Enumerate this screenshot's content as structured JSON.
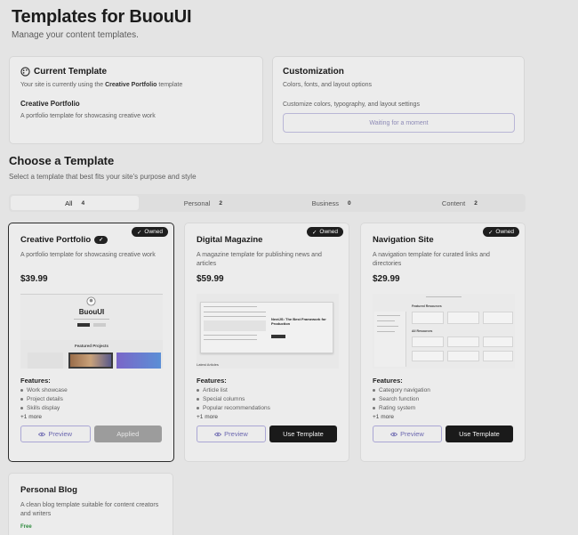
{
  "header": {
    "title": "Templates for BuouUI",
    "subtitle": "Manage your content templates."
  },
  "current_template": {
    "heading": "Current Template",
    "text_prefix": "Your site is currently using the",
    "template_name_bold": "Creative Portfolio",
    "text_suffix": "template",
    "name": "Creative Portfolio",
    "description": "A portfolio template for showcasing creative work"
  },
  "customization": {
    "heading": "Customization",
    "subtext": "Colors, fonts, and layout options",
    "description": "Customize colors, typography, and layout settings",
    "button_label": "Waiting for a moment"
  },
  "choose": {
    "title": "Choose a Template",
    "subtitle": "Select a template that best fits your site's purpose and style"
  },
  "tabs": [
    {
      "label": "All",
      "count": "4"
    },
    {
      "label": "Personal",
      "count": "2"
    },
    {
      "label": "Business",
      "count": "0"
    },
    {
      "label": "Content",
      "count": "2"
    }
  ],
  "cards": [
    {
      "title": "Creative Portfolio",
      "badge": "Owned",
      "description": "A portfolio template for showcasing creative work",
      "price": "$39.99",
      "features_heading": "Features:",
      "features": [
        "Work showcase",
        "Project details",
        "Skills display"
      ],
      "more": "+1 more",
      "preview_label": "Preview",
      "action_label": "Applied",
      "preview_brand": "BuouUI",
      "preview_section": "Featured Projects"
    },
    {
      "title": "Digital Magazine",
      "badge": "Owned",
      "description": "A magazine template for publishing news and articles",
      "price": "$59.99",
      "features_heading": "Features:",
      "features": [
        "Article list",
        "Special columns",
        "Popular recommendations"
      ],
      "more": "+1 more",
      "preview_label": "Preview",
      "action_label": "Use Template",
      "preview_headline": "NextJS: The Best Framework for Production",
      "preview_footer": "Latest Articles"
    },
    {
      "title": "Navigation Site",
      "badge": "Owned",
      "description": "A navigation template for curated links and directories",
      "price": "$29.99",
      "features_heading": "Features:",
      "features": [
        "Category navigation",
        "Search function",
        "Rating system"
      ],
      "more": "+1 more",
      "preview_label": "Preview",
      "action_label": "Use Template",
      "preview_section1": "Featured Resources",
      "preview_section2": "All Resources"
    },
    {
      "title": "Personal Blog",
      "description": "A clean blog template suitable for content creators and writers",
      "price": "Free"
    }
  ],
  "colors": {
    "background": "#e4e4e4",
    "card": "#ececec",
    "accent": "#6c68b0",
    "primary_button": "#1a1a1a",
    "free": "#2c8a3c"
  }
}
